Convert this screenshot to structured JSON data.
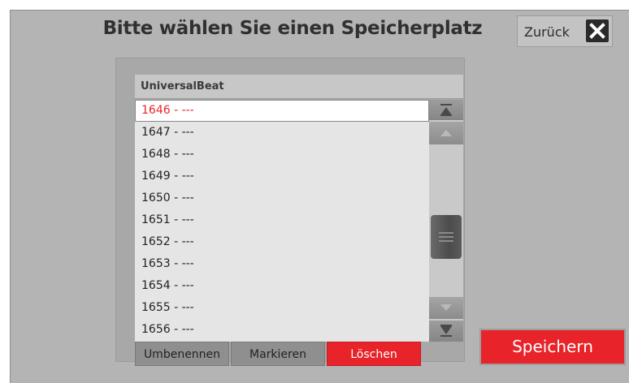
{
  "dialog": {
    "title": "Bitte wählen Sie einen Speicherplatz",
    "back_label": "Zurück",
    "close_icon": "close-icon"
  },
  "list": {
    "header": "UniversalBeat",
    "selected_index": 0,
    "items": [
      "1646 - ---",
      "1647 - ---",
      "1648 - ---",
      "1649 - ---",
      "1650 - ---",
      "1651 - ---",
      "1652 - ---",
      "1653 - ---",
      "1654 - ---",
      "1655 - ---",
      "1656 - ---"
    ]
  },
  "scrollbar": {
    "icons": [
      "scroll-to-top-icon",
      "scroll-up-icon",
      "scroll-thumb",
      "scroll-down-icon",
      "scroll-to-bottom-icon"
    ]
  },
  "actions": {
    "rename_label": "Umbenennen",
    "mark_label": "Markieren",
    "delete_label": "Löschen",
    "save_label": "Speichern"
  },
  "colors": {
    "accent_red": "#e8232a",
    "selected_text": "#e8252b",
    "panel_gray": "#b4b4b4"
  }
}
